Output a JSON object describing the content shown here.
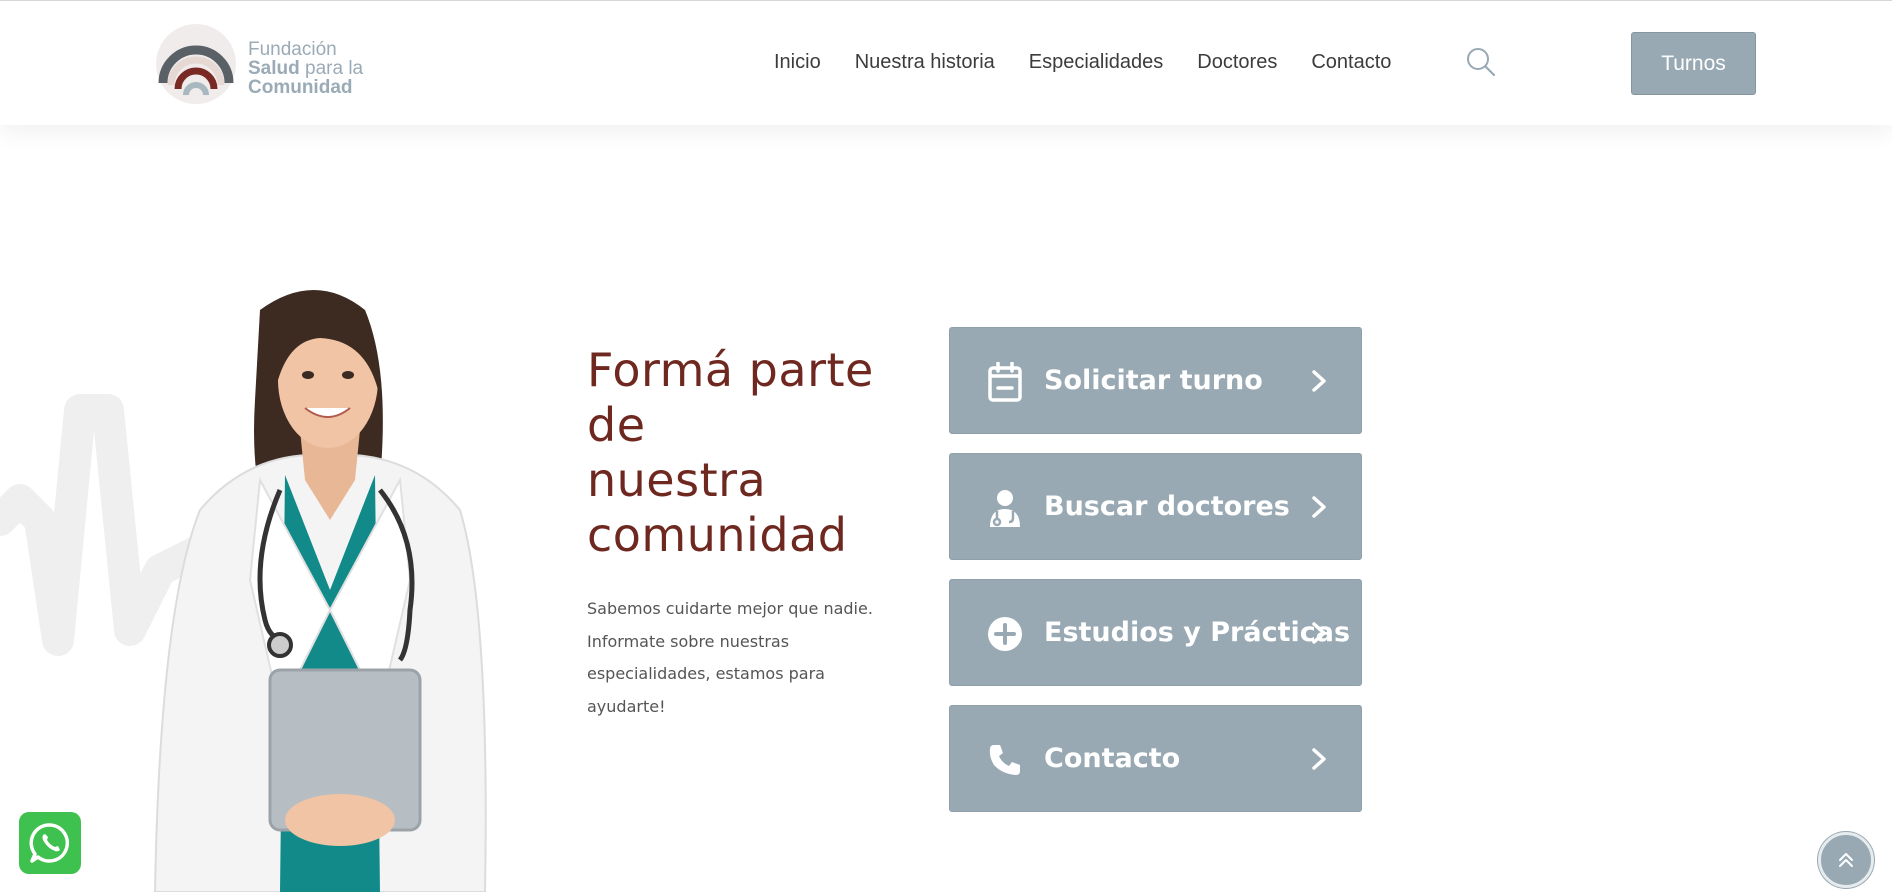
{
  "header": {
    "logo": {
      "line1": "Fundación",
      "line2_bold": "Salud",
      "line2_rest": " para la",
      "line3": "Comunidad"
    },
    "nav": [
      "Inicio",
      "Nuestra historia",
      "Especialidades",
      "Doctores",
      "Contacto"
    ],
    "search_icon": "search-icon",
    "turnos_label": "Turnos"
  },
  "hero": {
    "headline": [
      "Formá parte",
      "de",
      "nuestra",
      "comunidad"
    ],
    "subtext": [
      "Sabemos cuidarte mejor que nadie.",
      "Informate sobre nuestras",
      "especialidades, estamos para ayudarte!"
    ],
    "cta_buttons": [
      {
        "label": "Solicitar turno",
        "icon": "calendar-icon"
      },
      {
        "label": "Buscar doctores",
        "icon": "doctor-icon"
      },
      {
        "label": "Estudios y Prácticas",
        "icon": "plus-circle-icon"
      },
      {
        "label": "Contacto",
        "icon": "phone-icon"
      }
    ]
  },
  "floating": {
    "whatsapp_icon": "whatsapp-icon",
    "scroll_top_icon": "double-chevron-up-icon"
  },
  "colors": {
    "accent_gray": "#98a9b3",
    "headline_red": "#6e2820",
    "whatsapp_green": "#3ec14f"
  }
}
